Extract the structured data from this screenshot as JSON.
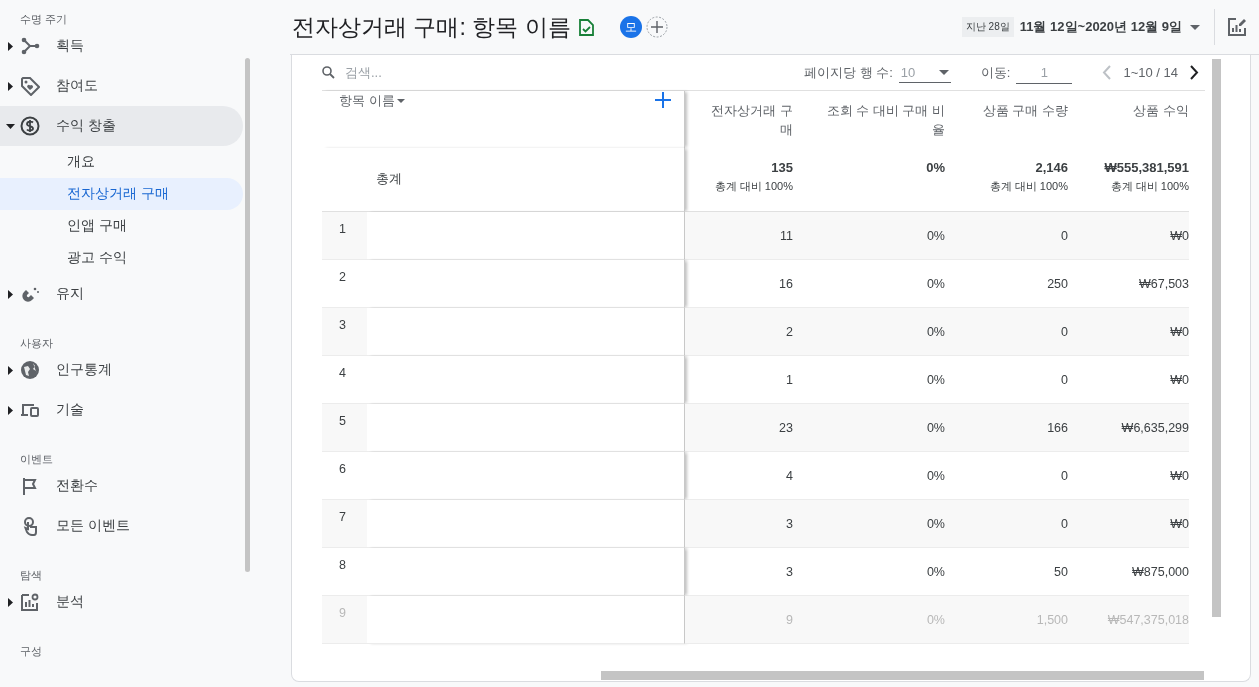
{
  "sidebar": {
    "sections": [
      {
        "heading": "수명 주기",
        "items": [
          {
            "label": "획득",
            "expanded": false
          },
          {
            "label": "참여도",
            "expanded": false
          },
          {
            "label": "수익 창출",
            "expanded": true,
            "children": [
              {
                "label": "개요",
                "selected": false
              },
              {
                "label": "전자상거래 구매",
                "selected": true
              },
              {
                "label": "인앱 구매",
                "selected": false
              },
              {
                "label": "광고 수익",
                "selected": false
              }
            ]
          },
          {
            "label": "유지",
            "expanded": false
          }
        ]
      },
      {
        "heading": "사용자",
        "items": [
          {
            "label": "인구통계",
            "expanded": false
          },
          {
            "label": "기술",
            "expanded": false
          }
        ]
      },
      {
        "heading": "이벤트",
        "items": [
          {
            "label": "전환수"
          },
          {
            "label": "모든 이벤트"
          }
        ]
      },
      {
        "heading": "탐색",
        "items": [
          {
            "label": "분석",
            "expanded": false
          }
        ]
      },
      {
        "heading": "구성"
      }
    ]
  },
  "header": {
    "title": "전자상거래 구매: 항목 이름",
    "comparison_badge": "모",
    "period_chip": "지난 28일",
    "date_range": "11월 12일~2020년 12월 9일"
  },
  "table": {
    "search": {
      "placeholder": "검색..."
    },
    "pagination": {
      "rows_label": "페이지당 행 수:",
      "rows_per_page": "10",
      "goto_label": "이동:",
      "goto_value": "1",
      "range": "1~10 / 14",
      "prev_disabled": true,
      "next_disabled": false
    },
    "dimension_column": "항목 이름",
    "columns": [
      "전자상거래 구매",
      "조회 수 대비 구매 비율",
      "상품 구매 수량",
      "상품 수익"
    ],
    "totals": {
      "label": "총계",
      "values": [
        {
          "value": "135",
          "share": "총계 대비 100%"
        },
        {
          "value": "0%"
        },
        {
          "value": "2,146",
          "share": "총계 대비 100%"
        },
        {
          "value": "₩555,381,591",
          "share": "총계 대비 100%"
        }
      ]
    },
    "rows": [
      {
        "index": "1",
        "values": [
          "11",
          "0%",
          "0",
          "₩0"
        ],
        "faded": false
      },
      {
        "index": "2",
        "values": [
          "16",
          "0%",
          "250",
          "₩67,503"
        ],
        "faded": false
      },
      {
        "index": "3",
        "values": [
          "2",
          "0%",
          "0",
          "₩0"
        ],
        "faded": false
      },
      {
        "index": "4",
        "values": [
          "1",
          "0%",
          "0",
          "₩0"
        ],
        "faded": false
      },
      {
        "index": "5",
        "values": [
          "23",
          "0%",
          "166",
          "₩6,635,299"
        ],
        "faded": false
      },
      {
        "index": "6",
        "values": [
          "4",
          "0%",
          "0",
          "₩0"
        ],
        "faded": false
      },
      {
        "index": "7",
        "values": [
          "3",
          "0%",
          "0",
          "₩0"
        ],
        "faded": false
      },
      {
        "index": "8",
        "values": [
          "3",
          "0%",
          "50",
          "₩875,000"
        ],
        "faded": false
      },
      {
        "index": "9",
        "values": [
          "9",
          "0%",
          "1,500",
          "₩547,375,018"
        ],
        "faded": true
      }
    ]
  }
}
